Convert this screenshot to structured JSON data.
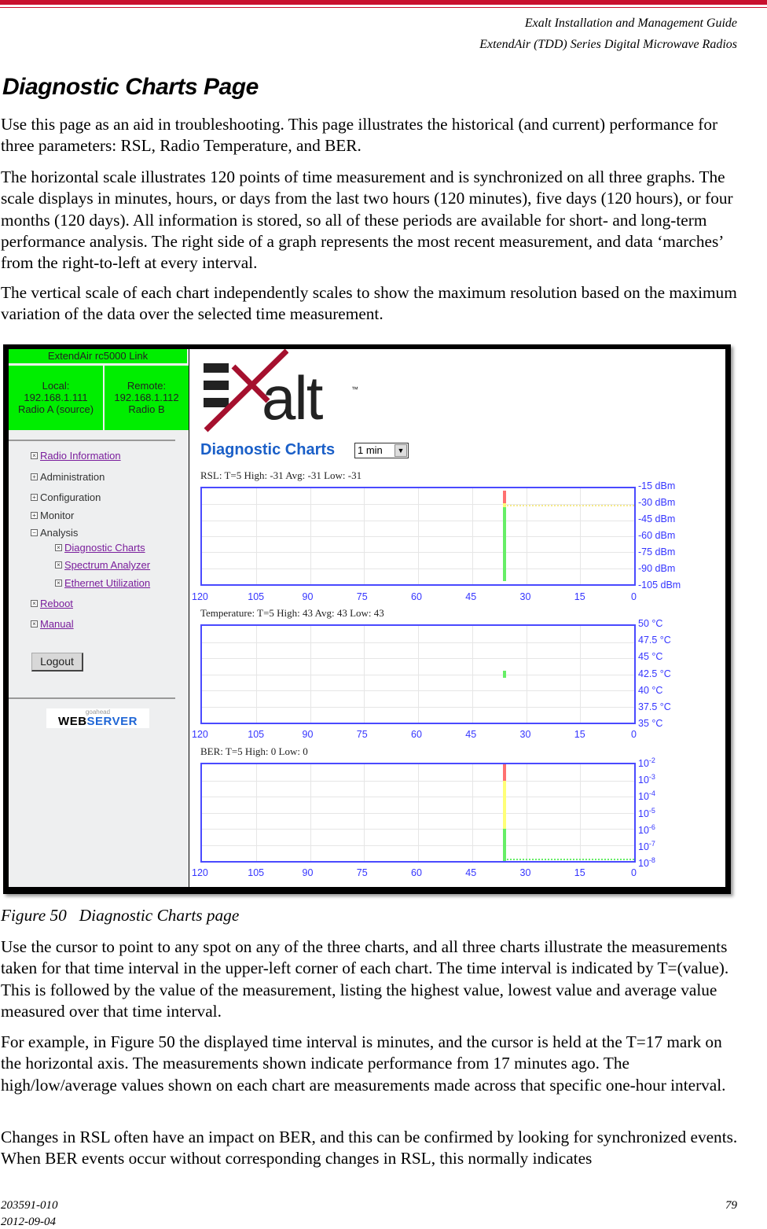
{
  "header": {
    "line1": "Exalt Installation and Management Guide",
    "line2": "ExtendAir (TDD) Series Digital Microwave Radios"
  },
  "title": "Diagnostic Charts Page",
  "paragraphs_top": [
    "Use this page as an aid in troubleshooting. This page illustrates the historical (and current) performance for three parameters: RSL, Radio Temperature, and BER.",
    "The horizontal scale illustrates 120 points of time measurement and is synchronized on all three graphs. The scale displays in minutes, hours, or days from the last two hours (120 minutes), five days (120 hours), or four months (120 days). All information is stored, so all of these periods are available for short- and long-term performance analysis. The right side of a graph represents the most recent measurement, and data ‘marches’ from the right-to-left at every interval.",
    "The vertical scale of each chart independently scales to show the maximum resolution based on the maximum variation of the data over the selected time measurement."
  ],
  "figure": {
    "sidebar": {
      "link_title": "ExtendAir rc5000 Link",
      "local": {
        "label": "Local:",
        "ip": "192.168.1.111",
        "name": "Radio A (source)"
      },
      "remote": {
        "label": "Remote:",
        "ip": "192.168.1.112",
        "name": "Radio B"
      },
      "nav": [
        {
          "label": "Radio Information",
          "icon": "x-box",
          "link": true
        },
        {
          "label": "Administration",
          "icon": "plus-box",
          "link": false
        },
        {
          "label": "Configuration",
          "icon": "plus-box",
          "link": false
        },
        {
          "label": "Monitor",
          "icon": "plus-box",
          "link": false
        },
        {
          "label": "Analysis",
          "icon": "minus-box",
          "link": false
        },
        {
          "label": "Diagnostic Charts",
          "icon": "x-box",
          "link": true
        },
        {
          "label": "Spectrum Analyzer",
          "icon": "x-box",
          "link": true
        },
        {
          "label": "Ethernet Utilization",
          "icon": "x-box",
          "link": true
        },
        {
          "label": "Reboot",
          "icon": "x-box",
          "link": true
        },
        {
          "label": "Manual",
          "icon": "x-box",
          "link": true
        }
      ],
      "logout": "Logout",
      "webserver": {
        "small": "goahead",
        "web": "WEB",
        "server": "SERVER"
      }
    },
    "logo": {
      "text": "alt",
      "tm": "™"
    },
    "page_heading": "Diagnostic Charts",
    "interval_select": "1 min",
    "accent": "#1a5fc8"
  },
  "chart_data": [
    {
      "type": "bar",
      "title": "RSL: T=5 High: -31 Avg: -31 Low: -31",
      "x_ticks": [
        "120",
        "105",
        "90",
        "75",
        "60",
        "45",
        "30",
        "15",
        "0"
      ],
      "xlim": [
        120,
        0
      ],
      "y_ticks": [
        "-15 dBm",
        "-30 dBm",
        "-45 dBm",
        "-60 dBm",
        "-75 dBm",
        "-90 dBm",
        "-105 dBm"
      ],
      "ylim": [
        -105,
        -15
      ],
      "grid": true,
      "segments": [
        {
          "x": 36,
          "from": -102,
          "to": -33,
          "color": "#66ee66"
        },
        {
          "x": 36,
          "from": -33,
          "to": -29,
          "color": "#ffff77"
        },
        {
          "x": 36,
          "from": -29,
          "to": -17,
          "color": "#ff7070"
        }
      ],
      "dotted": {
        "value": -31,
        "from_x": 36,
        "to_x": 0,
        "color": "#f5e98a"
      }
    },
    {
      "type": "bar",
      "title": "Temperature: T=5 High: 43 Avg: 43 Low: 43",
      "x_ticks": [
        "120",
        "105",
        "90",
        "75",
        "60",
        "45",
        "30",
        "15",
        "0"
      ],
      "xlim": [
        120,
        0
      ],
      "y_ticks": [
        "50 °C",
        "47.5 °C",
        "45 °C",
        "42.5 °C",
        "40 °C",
        "37.5 °C",
        "35 °C"
      ],
      "ylim": [
        35,
        50
      ],
      "grid": true,
      "segments": [
        {
          "x": 36,
          "from": 42,
          "to": 43,
          "color": "#66ee66"
        }
      ]
    },
    {
      "type": "bar",
      "title": "BER: T=5 High: 0 Low: 0",
      "x_ticks": [
        "120",
        "105",
        "90",
        "75",
        "60",
        "45",
        "30",
        "15",
        "0"
      ],
      "xlim": [
        120,
        0
      ],
      "y_ticks": [
        "-2",
        "-3",
        "-4",
        "-5",
        "-6",
        "-7",
        "-8"
      ],
      "y_tick_base": "10",
      "ylim": [
        -8,
        -2
      ],
      "log_scale": true,
      "grid": true,
      "segments": [
        {
          "x": 36,
          "from": -8,
          "to": -6,
          "color": "#66ee66"
        },
        {
          "x": 36,
          "from": -6,
          "to": -3,
          "color": "#ffff77"
        },
        {
          "x": 36,
          "from": -3,
          "to": -2,
          "color": "#ff7070"
        }
      ],
      "dotted": {
        "value": -8,
        "from_x": 36,
        "to_x": 0,
        "color": "#66ee66"
      }
    }
  ],
  "caption": {
    "number": "Figure 50",
    "text": "Diagnostic Charts page"
  },
  "paragraphs_bottom": [
    "Use the cursor to point to any spot on any of the three charts, and all three charts illustrate the measurements taken for that time interval in the upper-left corner of each chart. The time interval is indicated by T=(value). This is followed by the value of the measurement, listing the highest value, lowest value and average value measured over that time interval.",
    "For example, in Figure 50 the displayed time interval is minutes, and the cursor is held at the T=17 mark on the horizontal axis. The measurements shown indicate performance from 17 minutes ago. The high/low/average values shown on each chart are measurements made across that specific one-hour interval.",
    "Changes in RSL often have an impact on BER, and this can be confirmed by looking for synchronized events. When BER events occur without corresponding changes in RSL, this normally indicates"
  ],
  "footer": {
    "doc_number": "203591-010",
    "date": "2012-09-04",
    "page": "79"
  }
}
